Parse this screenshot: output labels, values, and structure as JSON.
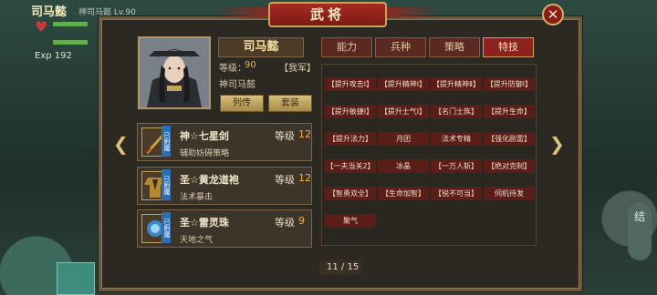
{
  "window": {
    "title": "武将"
  },
  "background": {
    "hud_name": "司马懿",
    "hud_sub": "神司马懿 Lv.90",
    "exp_text": "Exp 192",
    "right_button": "结"
  },
  "hero": {
    "name": "司马懿",
    "level_label": "等级：",
    "level_value": "90",
    "faction": "【我军】",
    "title": "神司马懿",
    "bio_button": "列传",
    "set_button": "套装"
  },
  "tabs": [
    {
      "label": "能力",
      "active": false
    },
    {
      "label": "兵种",
      "active": false
    },
    {
      "label": "策略",
      "active": false
    },
    {
      "label": "特技",
      "active": true
    }
  ],
  "equipment": [
    {
      "badge": "已附魔",
      "name": "神☆七星剑",
      "level_label": "等级",
      "level": "12",
      "desc": "辅助妨碍策略"
    },
    {
      "badge": "已附魔",
      "name": "圣☆黄龙道袍",
      "level_label": "等级",
      "level": "12",
      "desc": "法术暴击"
    },
    {
      "badge": "已附魔",
      "name": "圣☆雷灵珠",
      "level_label": "等级",
      "level": "9",
      "desc": "天地之气"
    }
  ],
  "skills": [
    "【提升攻击Ⅰ】",
    "【提升精神Ⅰ】",
    "【提升精神Ⅱ】",
    "【提升防御Ⅰ】",
    "【提升敏捷Ⅰ】",
    "【提升士气Ⅰ】",
    "【名门士族】",
    "【提升生命】",
    "【提升法力】",
    "月团",
    "法术专精",
    "【强化剧雷】",
    "【一夫当关2】",
    "冰晶",
    "【一万人斩】",
    "【绝对克制】",
    "【智勇双全】",
    "【生命加智】",
    "【锐不可当】",
    "伺机待发",
    "聚气"
  ],
  "pager": {
    "text": "11 / 15"
  },
  "colors": {
    "accent_red": "#8c211d",
    "gold": "#f0b04a",
    "panel_bg": "#2c2822"
  }
}
